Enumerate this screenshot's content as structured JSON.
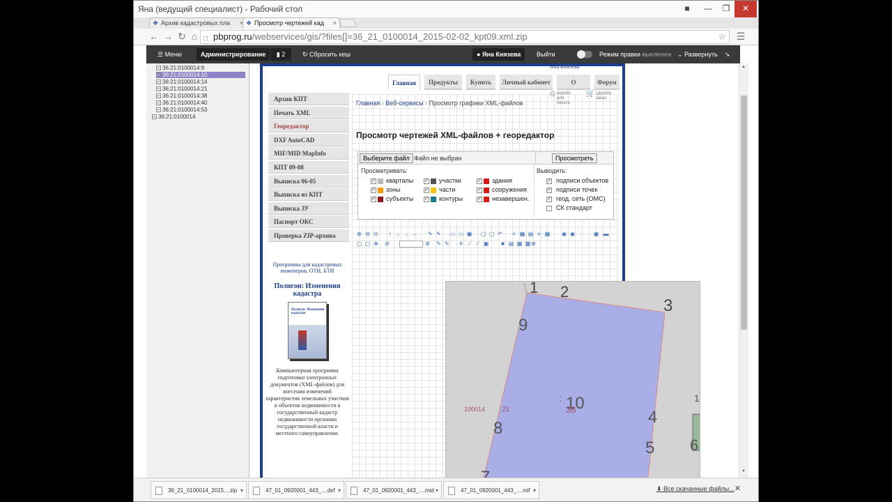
{
  "window": {
    "title": "Яна (ведущий специалист) - Рабочий стол"
  },
  "tabs": [
    {
      "label": "Архив кадастровых пла"
    },
    {
      "label": "Просмотр чертежей кад"
    }
  ],
  "address": {
    "host": "pbprog.ru",
    "path": "/webservices/gis/?files[]=36_21_0100014_2015-02-02_kpt09.xml.zip"
  },
  "adminbar": {
    "menu": "Меню",
    "admin": "Администрирование",
    "count": "2",
    "reset_cache": "Сбросить кеш",
    "user": "Яна Князева",
    "logout": "Выйти",
    "edit_mode": "Режим правки",
    "edit_state": "выключен",
    "expand": "Развернуть"
  },
  "tree": [
    {
      "label": "36:21:0100014:9",
      "level": 1
    },
    {
      "label": "36:21:0100014:10",
      "level": 1,
      "selected": true
    },
    {
      "label": "36:21:0100014:14",
      "level": 1
    },
    {
      "label": "36:21:0100014:21",
      "level": 1
    },
    {
      "label": "36:21:0100014:38",
      "level": 1
    },
    {
      "label": "36:21:0100014:40",
      "level": 1
    },
    {
      "label": "36:21:0100014:53",
      "level": 1
    },
    {
      "label": "36:21:0100014",
      "level": 0
    }
  ],
  "site": {
    "top_user": "Яна Князева",
    "topnav": [
      "Главная",
      "Продукты",
      "Купить",
      "Личный кабинет",
      "О компании",
      "Форум"
    ],
    "sidemenu": [
      "Архив КПТ",
      "Печать XML",
      "Георедактор",
      "DXF AutoCAD",
      "MIF/MID MapInfo",
      "КПТ 09-08",
      "Выписка 06-05",
      "Выписка из КПТ",
      "Выписка ЗУ",
      "Паспорт ОКС",
      "Проверка ZIP-архива"
    ],
    "promo_link": "Программы для кадастровых инженеров, ОТИ, БТИ",
    "promo_title": "Полигон: Изменения кадастра",
    "promo_box": "Полигон: Изменения кадастра",
    "promo_text": "Компьютерная программа подготовки электронных документов (XML-файлов) для внесения изменений характеристик земельных участков и объектов недвижимости в государственный кадастр недвижимости органами государственной власти и местного самоуправления.",
    "breadcrumb": [
      "Главная",
      "Веб-сервисы",
      "Просмотр графики XML-файлов"
    ],
    "print_version": "версия для печати",
    "make_order": "сделать заказ",
    "heading": "Просмотр чертежей XML-файлов + георедактор",
    "choose_file": "Выберите файл",
    "no_file": "Файл не выбран",
    "view_btn": "Просмотреть",
    "view_label": "Просматривать:",
    "output_label": "Выводить:",
    "layers": [
      {
        "label": "кварталы",
        "color": "#b8b8b8",
        "checked": true
      },
      {
        "label": "участки",
        "color": "#555555",
        "checked": true
      },
      {
        "label": "здания",
        "color": "#d11a1a",
        "checked": true
      },
      {
        "label": "зоны",
        "color": "#f39c12",
        "checked": true
      },
      {
        "label": "части",
        "color": "#f1c40f",
        "checked": true
      },
      {
        "label": "сооружения",
        "color": "#d11a1a",
        "checked": true
      },
      {
        "label": "субъекты",
        "color": "#8b1a1a",
        "checked": true
      },
      {
        "label": "контуры",
        "color": "#1a7a8a",
        "checked": true
      },
      {
        "label": "незавершен.",
        "color": "#d11a1a",
        "checked": true
      }
    ],
    "outputs": [
      {
        "label": "подписи объектов",
        "checked": true
      },
      {
        "label": "подписи точек",
        "checked": true
      },
      {
        "label": "геод. сеть (ОМС)",
        "checked": true
      },
      {
        "label": "СК стандарт",
        "checked": false
      }
    ],
    "map_labels": {
      "p1": "1",
      "p2": "2",
      "p3": "3",
      "p4": "4",
      "p5": "5",
      "p6": "6",
      "p7": "7",
      "p8": "8",
      "p9": "9",
      "p10": "10",
      "n21": "21",
      "n36": "36",
      "block": "100014",
      "tick": ":",
      "edge": "1"
    }
  },
  "downloads": [
    {
      "name": "36_21_0100014_2015....zip"
    },
    {
      "name": "47_01_0920001_443_....dxf"
    },
    {
      "name": "47_01_0920001_443_....mid"
    },
    {
      "name": "47_01_0920001_443_....mif"
    }
  ],
  "downloads_all": "Все скачанные файлы..."
}
